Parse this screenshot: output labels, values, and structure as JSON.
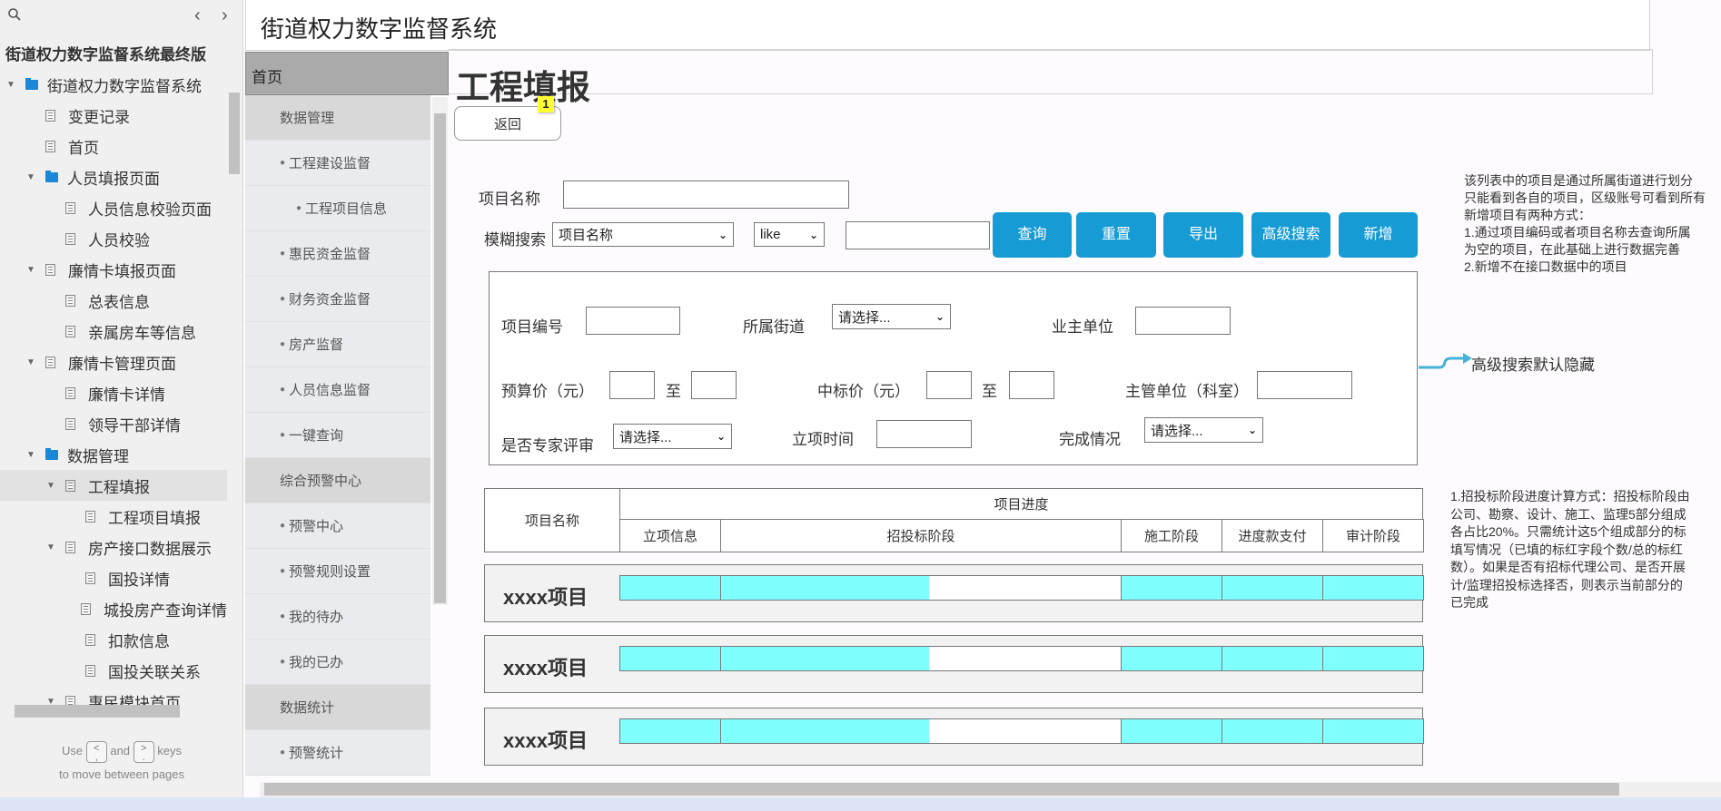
{
  "pages_panel": {
    "title": "街道权力数字监督系统最终版",
    "prev_label": "‹",
    "next_label": "›",
    "tree": [
      {
        "label": "街道权力数字监督系统",
        "type": "folder",
        "level": 0,
        "expanded": true
      },
      {
        "label": "变更记录",
        "type": "page",
        "level": 1
      },
      {
        "label": "首页",
        "type": "page",
        "level": 1
      },
      {
        "label": "人员填报页面",
        "type": "folder",
        "level": 1,
        "expanded": true
      },
      {
        "label": "人员信息校验页面",
        "type": "page",
        "level": 2
      },
      {
        "label": "人员校验",
        "type": "page",
        "level": 2
      },
      {
        "label": "廉情卡填报页面",
        "type": "page",
        "level": 1,
        "expanded": true
      },
      {
        "label": "总表信息",
        "type": "page",
        "level": 2
      },
      {
        "label": "亲属房车等信息",
        "type": "page",
        "level": 2
      },
      {
        "label": "廉情卡管理页面",
        "type": "page",
        "level": 1,
        "expanded": true
      },
      {
        "label": "廉情卡详情",
        "type": "page",
        "level": 2
      },
      {
        "label": "领导干部详情",
        "type": "page",
        "level": 2
      },
      {
        "label": "数据管理",
        "type": "folder",
        "level": 1,
        "expanded": true
      },
      {
        "label": "工程填报",
        "type": "page",
        "level": 2,
        "expanded": true,
        "selected": true
      },
      {
        "label": "工程项目填报",
        "type": "page",
        "level": 3
      },
      {
        "label": "房产接口数据展示",
        "type": "page",
        "level": 2,
        "expanded": true
      },
      {
        "label": "国投详情",
        "type": "page",
        "level": 3
      },
      {
        "label": "城投房产查询详情",
        "type": "page",
        "level": 3
      },
      {
        "label": "扣款信息",
        "type": "page",
        "level": 3
      },
      {
        "label": "国投关联关系",
        "type": "page",
        "level": 3
      },
      {
        "label": "惠民模块首页",
        "type": "page",
        "level": 2,
        "expanded": true
      }
    ],
    "hint_use": "Use",
    "hint_and": "and",
    "hint_keys": "keys",
    "hint_line2": "to move between pages",
    "key_prev": "<\n,",
    "key_next": ">\n."
  },
  "header": {
    "app_title": "街道权力数字监督系统"
  },
  "nav": {
    "home_label": "首页",
    "menu": [
      {
        "label": "数据管理",
        "kind": "group"
      },
      {
        "label": "工程建设监督",
        "kind": "sub"
      },
      {
        "label": "工程项目信息",
        "kind": "subsub"
      },
      {
        "label": "惠民资金监督",
        "kind": "sub"
      },
      {
        "label": "财务资金监督",
        "kind": "sub"
      },
      {
        "label": "房产监督",
        "kind": "sub"
      },
      {
        "label": "人员信息监督",
        "kind": "sub"
      },
      {
        "label": "一键查询",
        "kind": "sub"
      },
      {
        "label": "综合预警中心",
        "kind": "group"
      },
      {
        "label": "预警中心",
        "kind": "sub"
      },
      {
        "label": "预警规则设置",
        "kind": "sub"
      },
      {
        "label": "我的待办",
        "kind": "sub"
      },
      {
        "label": "我的已办",
        "kind": "sub"
      },
      {
        "label": "数据统计",
        "kind": "group"
      },
      {
        "label": "预警统计",
        "kind": "sub"
      }
    ]
  },
  "main": {
    "page_title": "工程填报",
    "back_label": "返回",
    "badge": "1",
    "search": {
      "project_name_label": "项目名称",
      "project_name_value": "",
      "fuzzy_label": "模糊搜索",
      "fuzzy_field": "项目名称",
      "fuzzy_op": "like",
      "fuzzy_value": ""
    },
    "buttons": {
      "query": "查询",
      "reset": "重置",
      "export": "导出",
      "advanced": "高级搜索",
      "add": "新增"
    },
    "advanced": {
      "code_label": "项目编号",
      "street_label": "所属街道",
      "street_value": "请选择...",
      "owner_label": "业主单位",
      "budget_label": "预算价（元）",
      "to_label": "至",
      "bid_label": "中标价（元）",
      "dept_label": "主管单位（科室）",
      "expert_label": "是否专家评审",
      "expert_value": "请选择...",
      "date_label": "立项时间",
      "status_label": "完成情况",
      "status_value": "请选择..."
    },
    "note_list": "该列表中的项目是通过所属街道进行划分\n只能看到各自的项目，区级账号可看到所有\n新增项目有两种方式：\n1.通过项目编码或者项目名称去查询所属\n为空的项目，在此基础上进行数据完善\n2.新增不在接口数据中的项目",
    "note_advanced": "高级搜索默认隐藏",
    "note_progress": "1.招投标阶段进度计算方式：招投标阶段由\n公司、勘察、设计、施工、监理5部分组成\n各占比20%。只需统计这5个组成部分的标\n填写情况（已填的标红字段个数/总的标红\n数）。如果是否有招标代理公司、是否开展\n计/监理招投标选择否，则表示当前部分的\n已完成",
    "table": {
      "col_name": "项目名称",
      "col_progress": "项目进度",
      "stages": [
        "立项信息",
        "招投标阶段",
        "施工阶段",
        "进度款支付",
        "审计阶段"
      ],
      "rows": [
        {
          "name": "xxxx项目",
          "progress": [
            1.0,
            0.52,
            1.0,
            1.0,
            1.0
          ]
        },
        {
          "name": "xxxx项目",
          "progress": [
            1.0,
            0.52,
            1.0,
            1.0,
            1.0
          ]
        },
        {
          "name": "xxxx项目",
          "progress": [
            1.0,
            0.52,
            1.0,
            1.0,
            1.0
          ]
        }
      ]
    },
    "colors": {
      "primary": "#169bd5",
      "progress_fill": "#80ffff",
      "badge": "#ffff33"
    }
  }
}
